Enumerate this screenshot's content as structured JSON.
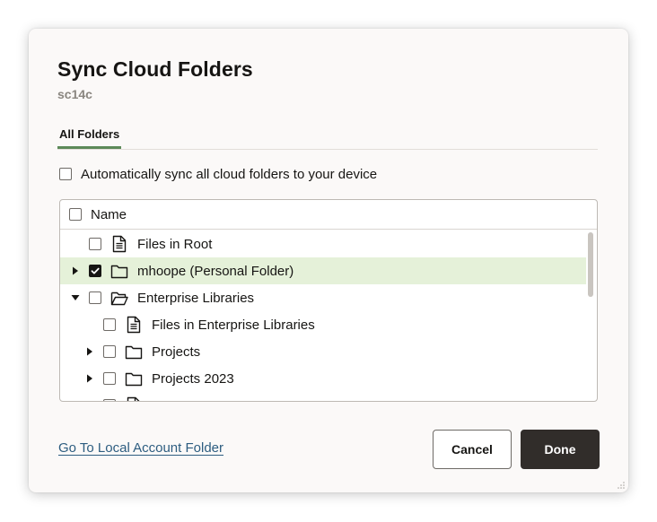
{
  "dialog": {
    "title": "Sync Cloud Folders",
    "subtitle": "sc14c"
  },
  "tabs": [
    {
      "label": "All Folders",
      "selected": true
    }
  ],
  "auto_sync": {
    "label": "Automatically sync all cloud folders to your device",
    "checked": false
  },
  "tree": {
    "header": {
      "label": "Name",
      "checked": false
    },
    "rows": [
      {
        "label": "Files in Root",
        "level": 0,
        "expander": "none",
        "checked": false,
        "icon": "file-icon",
        "selected": false
      },
      {
        "label": "mhoope (Personal Folder)",
        "level": 0,
        "expander": "collapsed",
        "checked": true,
        "icon": "folder-icon",
        "selected": true
      },
      {
        "label": "Enterprise Libraries",
        "level": 0,
        "expander": "expanded",
        "checked": false,
        "icon": "folder-open-icon",
        "selected": false
      },
      {
        "label": "Files in Enterprise Libraries",
        "level": 1,
        "expander": "none",
        "checked": false,
        "icon": "file-icon",
        "selected": false
      },
      {
        "label": "Projects",
        "level": 1,
        "expander": "collapsed",
        "checked": false,
        "icon": "folder-icon",
        "selected": false
      },
      {
        "label": "Projects 2023",
        "level": 1,
        "expander": "collapsed",
        "checked": false,
        "icon": "folder-icon",
        "selected": false
      },
      {
        "label": "",
        "level": 1,
        "expander": "collapsed",
        "checked": false,
        "icon": "file-icon",
        "selected": false
      }
    ]
  },
  "footer": {
    "link_label": "Go To Local Account Folder",
    "cancel_label": "Cancel",
    "done_label": "Done"
  },
  "colors": {
    "selected_row": "#e5f1d9",
    "tab_indicator": "#5d8a59",
    "primary_button": "#312d2a",
    "link": "#2d5d80"
  }
}
